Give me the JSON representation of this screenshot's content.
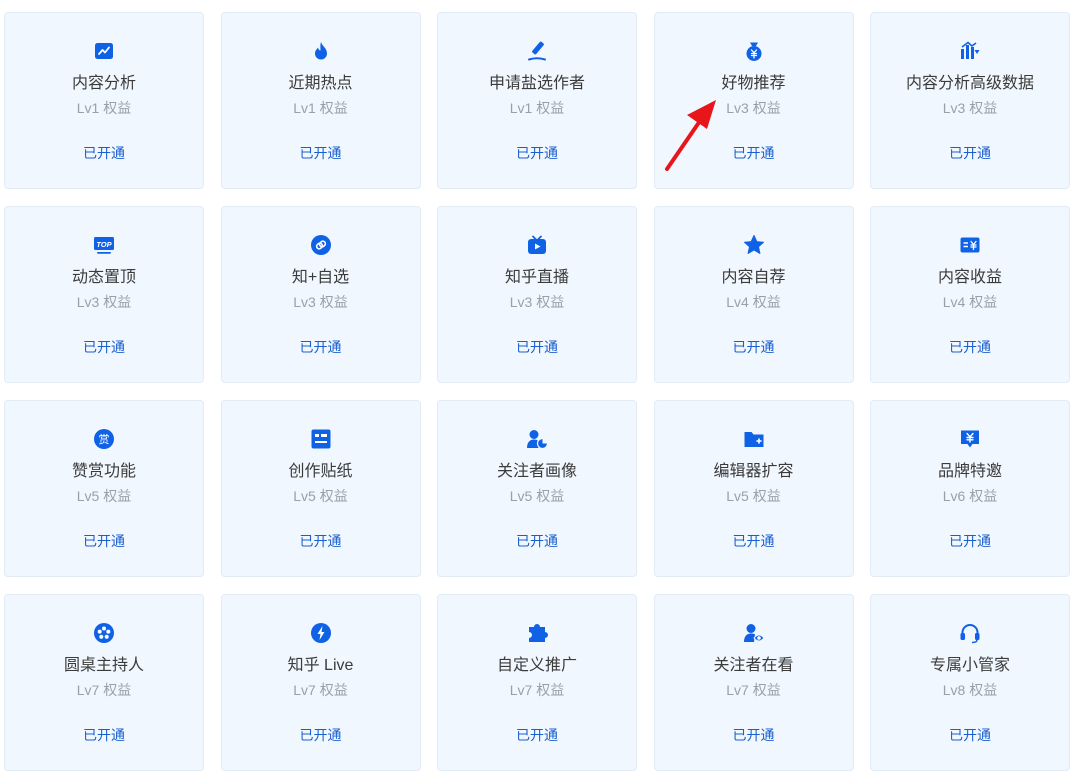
{
  "accent_color": "#0f62e6",
  "benefits": [
    {
      "name": "内容分析",
      "level": "Lv1 权益",
      "status": "已开通",
      "icon": "trend-chart-icon"
    },
    {
      "name": "近期热点",
      "level": "Lv1 权益",
      "status": "已开通",
      "icon": "flame-icon"
    },
    {
      "name": "申请盐选作者",
      "level": "Lv1 权益",
      "status": "已开通",
      "icon": "pen-icon"
    },
    {
      "name": "好物推荐",
      "level": "Lv3 权益",
      "status": "已开通",
      "icon": "money-bag-icon"
    },
    {
      "name": "内容分析高级数据",
      "level": "Lv3 权益",
      "status": "已开通",
      "icon": "bar-chart-down-icon"
    },
    {
      "name": "动态置顶",
      "level": "Lv3 权益",
      "status": "已开通",
      "icon": "top-badge-icon",
      "icon_text": "TOP"
    },
    {
      "name": "知+自选",
      "level": "Lv3 权益",
      "status": "已开通",
      "icon": "link-circle-icon"
    },
    {
      "name": "知乎直播",
      "level": "Lv3 权益",
      "status": "已开通",
      "icon": "tv-play-icon"
    },
    {
      "name": "内容自荐",
      "level": "Lv4 权益",
      "status": "已开通",
      "icon": "star-icon"
    },
    {
      "name": "内容收益",
      "level": "Lv4 权益",
      "status": "已开通",
      "icon": "yuan-card-icon"
    },
    {
      "name": "赞赏功能",
      "level": "Lv5 权益",
      "status": "已开通",
      "icon": "reward-coin-icon",
      "icon_text": "赏"
    },
    {
      "name": "创作贴纸",
      "level": "Lv5 权益",
      "status": "已开通",
      "icon": "sticker-icon"
    },
    {
      "name": "关注者画像",
      "level": "Lv5 权益",
      "status": "已开通",
      "icon": "user-pie-icon"
    },
    {
      "name": "编辑器扩容",
      "level": "Lv5 权益",
      "status": "已开通",
      "icon": "folder-plus-icon"
    },
    {
      "name": "品牌特邀",
      "level": "Lv6 权益",
      "status": "已开通",
      "icon": "yuan-message-icon"
    },
    {
      "name": "圆桌主持人",
      "level": "Lv7 权益",
      "status": "已开通",
      "icon": "round-table-icon"
    },
    {
      "name": "知乎 Live",
      "level": "Lv7 权益",
      "status": "已开通",
      "icon": "lightning-icon"
    },
    {
      "name": "自定义推广",
      "level": "Lv7 权益",
      "status": "已开通",
      "icon": "puzzle-icon"
    },
    {
      "name": "关注者在看",
      "level": "Lv7 权益",
      "status": "已开通",
      "icon": "user-eye-icon"
    },
    {
      "name": "专属小管家",
      "level": "Lv8 权益",
      "status": "已开通",
      "icon": "headset-icon"
    }
  ],
  "annotation": {
    "icon": "red-arrow-icon",
    "color": "#e8151b"
  }
}
